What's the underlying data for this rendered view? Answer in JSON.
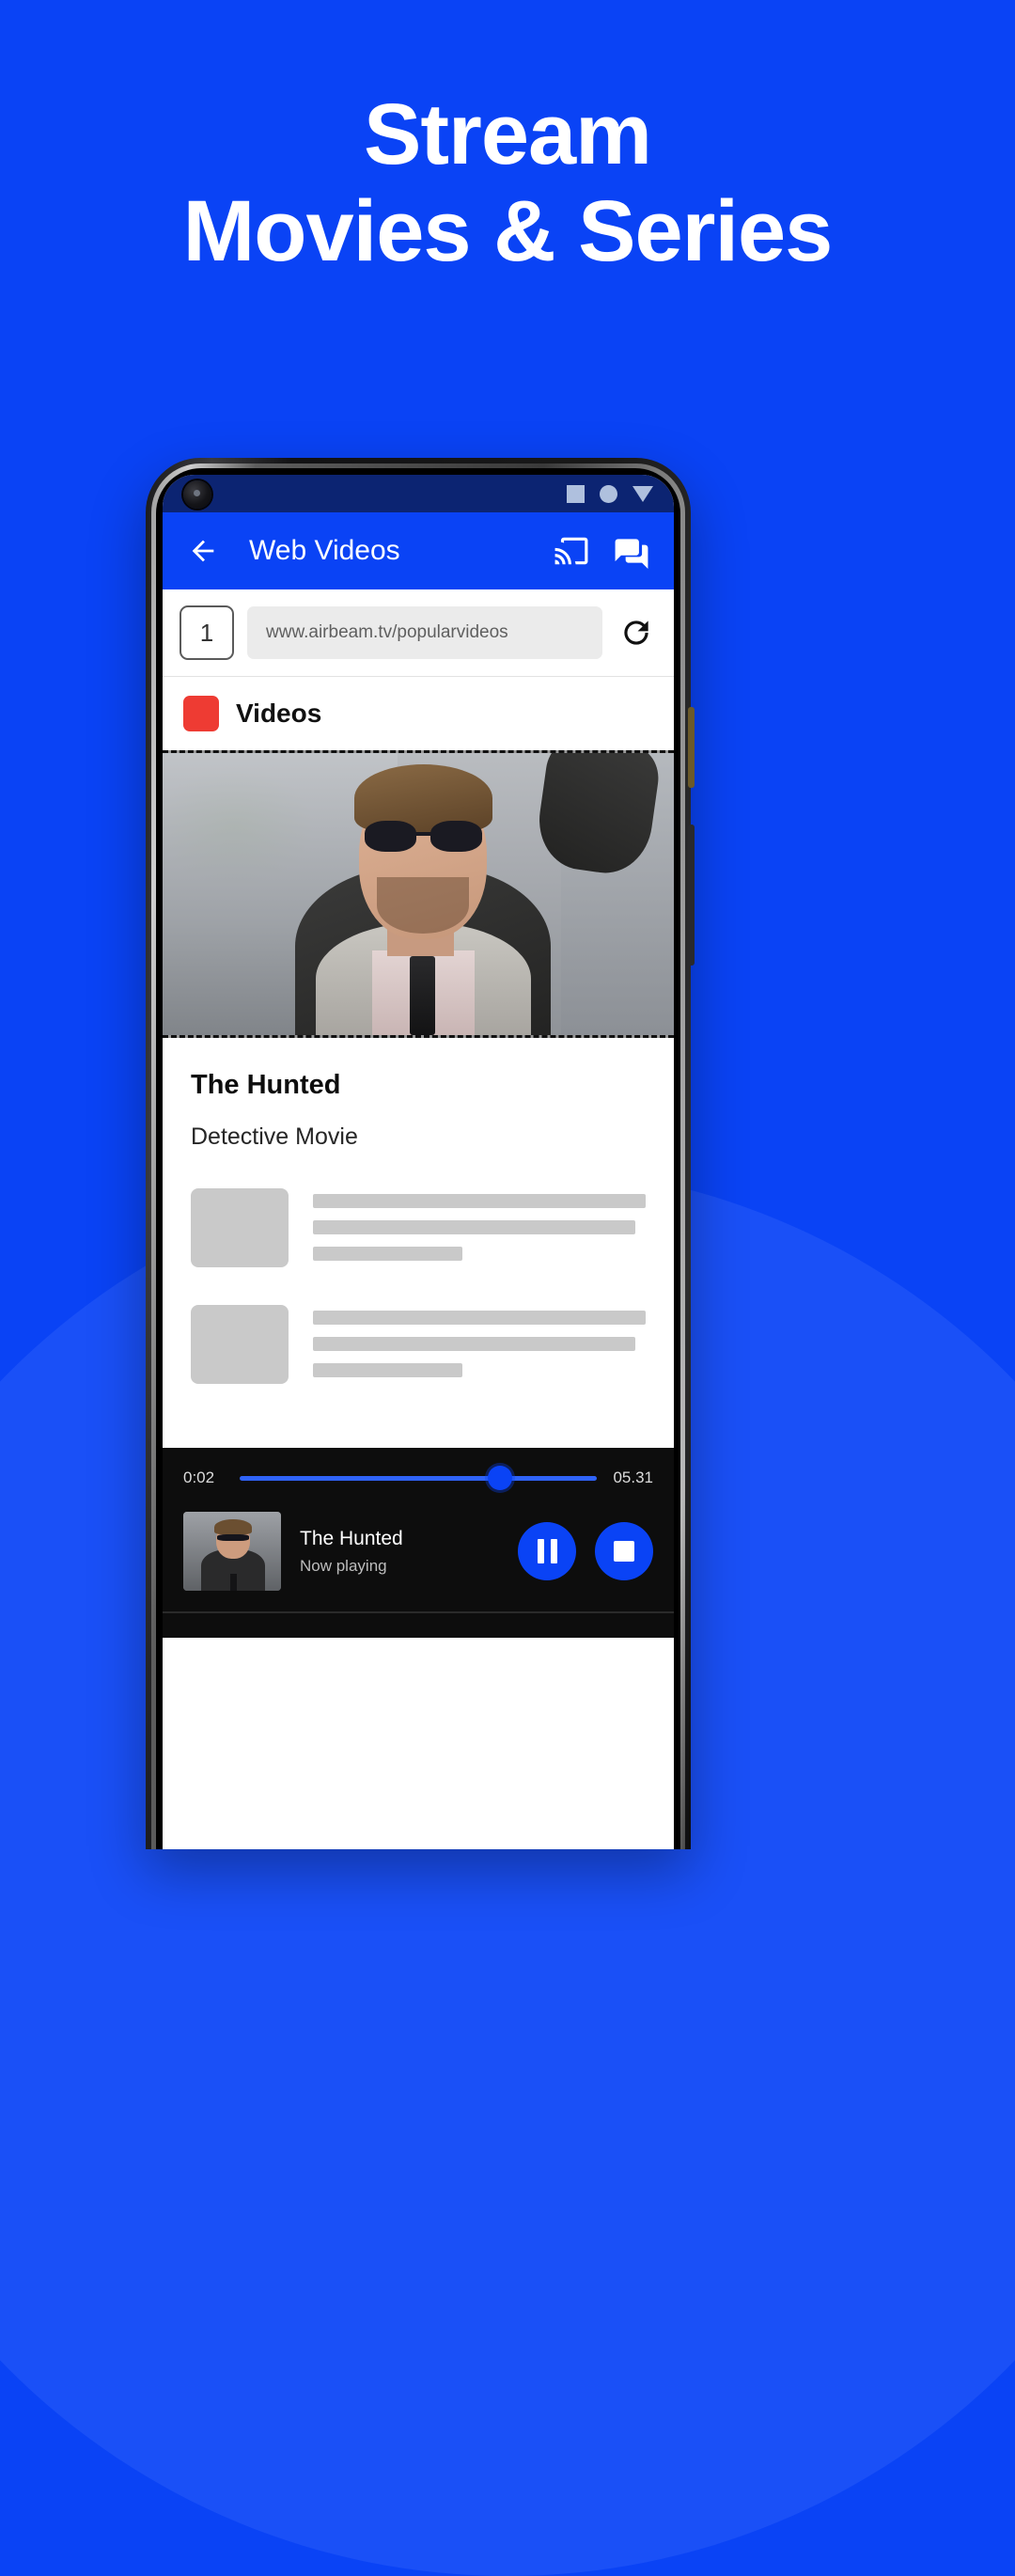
{
  "theme": {
    "background": "#0A43F5",
    "accent": "#0A43F5",
    "statusbar": "#0C2472",
    "brand_red": "#EE3B33",
    "player_bg": "#0D0D0D",
    "placeholder_gray": "#C9C9C9"
  },
  "promo": {
    "headline_line1": "Stream",
    "headline_line2": "Movies & Series"
  },
  "phone": {
    "statusbar": {
      "icons": [
        "square-icon",
        "circle-icon",
        "triangle-down-icon"
      ]
    },
    "appbar": {
      "back_icon": "arrow-left-icon",
      "title": "Web Videos",
      "cast_icon": "cast-icon",
      "chat_icon": "chat-bubble-icon"
    },
    "browser": {
      "tab_count": "1",
      "url_value": "www.airbeam.tv/popularvideos",
      "url_placeholder": "www.airbeam.tv/popularvideos",
      "reload_icon": "reload-icon"
    },
    "videos_section": {
      "badge_icon": "red-square-icon",
      "label": "Videos"
    },
    "video": {
      "poster_alt": "man-in-sunglasses-and-coat",
      "title": "The Hunted",
      "subtitle": "Detective Movie"
    },
    "placeholder_rows": [
      {
        "lines": [
          "w100",
          "w97",
          "w45"
        ]
      },
      {
        "lines": [
          "w100",
          "w97",
          "w45"
        ]
      }
    ],
    "player": {
      "current_time": "0:02",
      "total_time": "05.31",
      "progress_percent": 73,
      "track_title": "The Hunted",
      "track_status": "Now playing",
      "pause_icon": "pause-icon",
      "stop_icon": "stop-icon"
    }
  }
}
